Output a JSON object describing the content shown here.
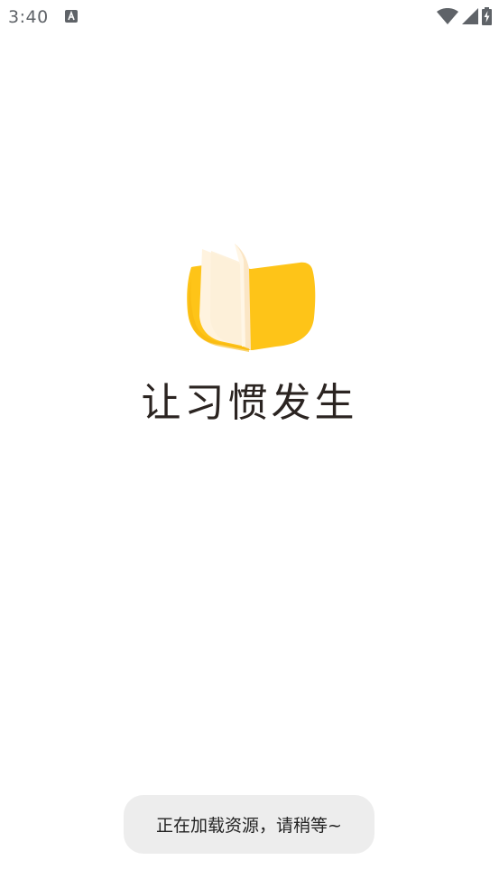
{
  "status_bar": {
    "time": "3:40",
    "notification_icon": "text-a-icon",
    "wifi_icon": "wifi-icon",
    "signal_icon": "cell-signal-icon",
    "battery_icon": "battery-charging-icon"
  },
  "splash": {
    "logo_icon": "open-book-icon",
    "slogan": "让习惯发生",
    "brand_color": "#fec418",
    "page_color": "#fff3df"
  },
  "toast": {
    "message": "正在加载资源，请稍等~"
  }
}
